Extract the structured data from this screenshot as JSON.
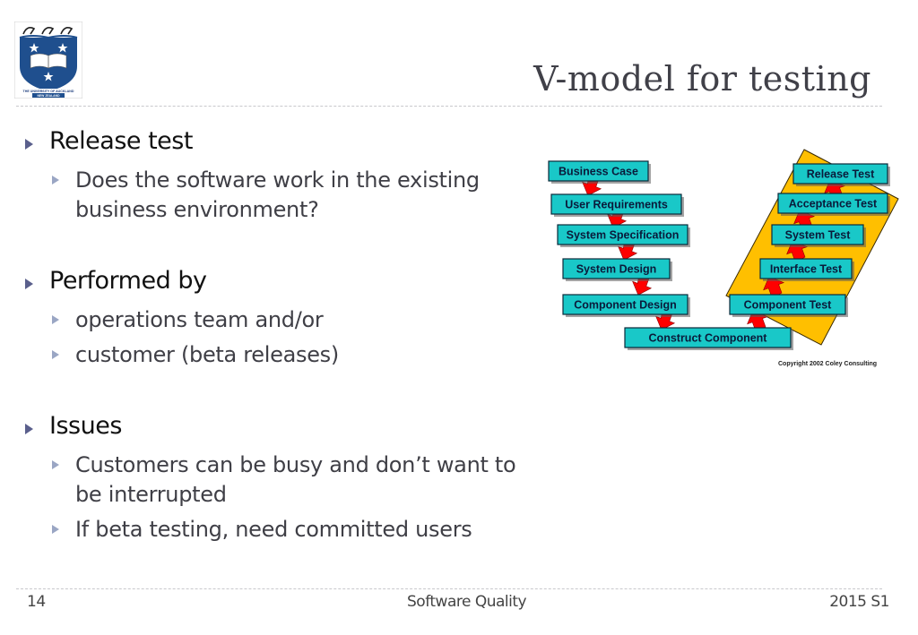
{
  "slide": {
    "title": "V-model for testing",
    "logo": {
      "name": "University of Auckland crest",
      "caption_line1": "THE UNIVERSITY OF AUCKLAND",
      "caption_line2": "NEW ZEALAND"
    },
    "bullets": [
      {
        "text": "Release test",
        "sub": [
          {
            "lines": [
              "Does the software work in the existing",
              "business environment?"
            ]
          }
        ]
      },
      {
        "text": "Performed by",
        "sub": [
          {
            "lines": [
              "operations team and/or"
            ]
          },
          {
            "lines": [
              "customer (beta releases)"
            ]
          }
        ]
      },
      {
        "text": "Issues",
        "sub": [
          {
            "lines": [
              "Customers can be busy and don’t want to",
              "be interrupted"
            ]
          },
          {
            "lines": [
              "If beta testing, need committed users"
            ]
          }
        ]
      }
    ],
    "footer": {
      "page_number": "14",
      "course": "Software Quality",
      "term": "2015 S1"
    }
  },
  "diagram": {
    "colors": {
      "box_fill": "#19c8c8",
      "box_border": "#0a2a3a",
      "arrow_fill": "#ff0000",
      "band_fill": "#ffbf00"
    },
    "left_arm": [
      "Business Case",
      "User Requirements",
      "System Specification",
      "System Design",
      "Component Design"
    ],
    "bottom": "Construct Component",
    "right_arm": [
      "Component Test",
      "Interface Test",
      "System Test",
      "Acceptance Test",
      "Release Test"
    ],
    "copyright": "Copyright 2002 Coley Consulting"
  }
}
